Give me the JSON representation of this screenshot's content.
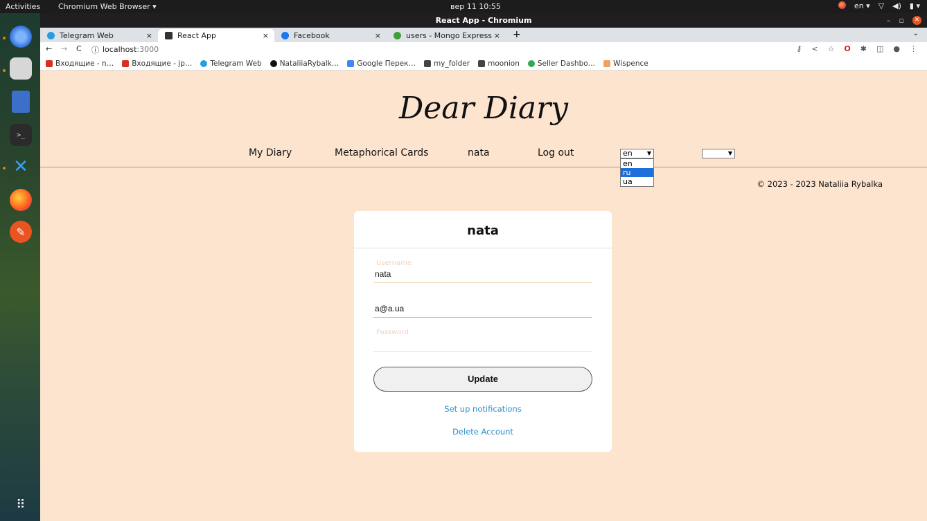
{
  "topbar": {
    "activities": "Activities",
    "app_menu": "Chromium Web Browser ▾",
    "clock": "вер 11  10:55",
    "lang": "en ▾",
    "tray_icons": [
      "network-icon",
      "volume-icon",
      "battery-icon",
      "system-menu-icon"
    ]
  },
  "dock": {
    "items": [
      "chromium-icon",
      "files-icon",
      "writer-icon",
      "terminal-icon",
      "vscode-icon",
      "firefox-icon",
      "editor-icon",
      "apps-grid-icon"
    ]
  },
  "window": {
    "title": "React App - Chromium"
  },
  "tabs": [
    {
      "label": "Telegram Web",
      "active": false,
      "color": "#2a9de0"
    },
    {
      "label": "React App",
      "active": true,
      "color": "#333333"
    },
    {
      "label": "Facebook",
      "active": false,
      "color": "#1877f2"
    },
    {
      "label": "users - Mongo Express",
      "active": false,
      "color": "#3fa037"
    }
  ],
  "address": {
    "url_host": "localhost",
    "url_port": ":3000"
  },
  "bookmarks": [
    {
      "label": "Входящие - n…",
      "color": "#d93025"
    },
    {
      "label": "Входящие - jp…",
      "color": "#d93025"
    },
    {
      "label": "Telegram Web",
      "color": "#2a9de0"
    },
    {
      "label": "NataliiaRybalk…",
      "color": "#111111"
    },
    {
      "label": "Google Перек…",
      "color": "#4285f4"
    },
    {
      "label": "my_folder",
      "color": "#444444"
    },
    {
      "label": "moonion",
      "color": "#444444"
    },
    {
      "label": "Seller Dashbo…",
      "color": "#34a853"
    },
    {
      "label": "Wispence",
      "color": "#f0a060"
    }
  ],
  "page": {
    "logo": "Dear Diary",
    "nav": {
      "my_diary": "My Diary",
      "cards": "Metaphorical Cards",
      "user": "nata",
      "logout": "Log out"
    },
    "lang_select": {
      "value": "en",
      "options": [
        "en",
        "ru",
        "ua"
      ],
      "highlighted": "ru"
    },
    "second_select_value": "",
    "copyright": "© 2023 - 2023 Nataliia Rybalka",
    "card": {
      "title": "nata",
      "username_label": "Username",
      "username_value": "nata",
      "email_value": "a@a.ua",
      "password_label": "Password",
      "password_value": "",
      "update_button": "Update",
      "notifications_link": "Set up notifications",
      "delete_link": "Delete Account"
    }
  }
}
